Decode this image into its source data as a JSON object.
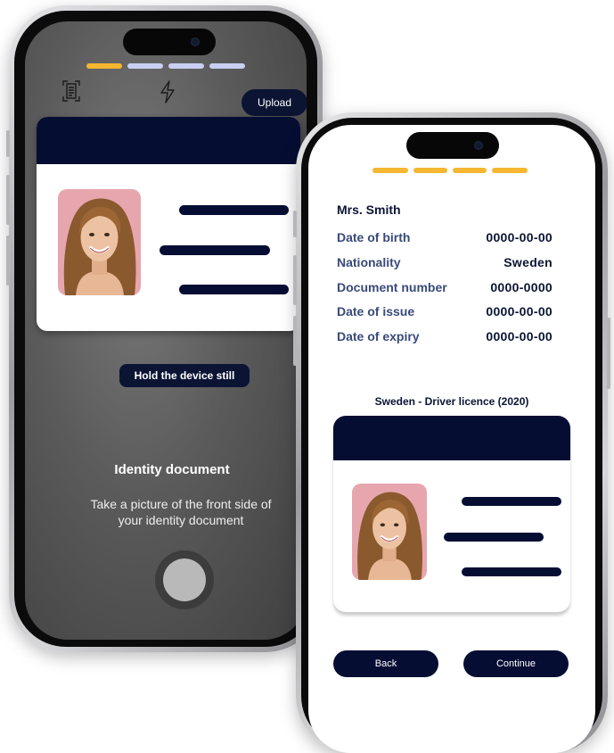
{
  "colors": {
    "navy": "#050d33",
    "progress_active": "#f5b731",
    "progress_inactive": "#c9cff2"
  },
  "scan_screen": {
    "progress": [
      {
        "state": "active"
      },
      {
        "state": "inactive"
      },
      {
        "state": "inactive"
      },
      {
        "state": "inactive"
      }
    ],
    "scan_icon": "document-scan-icon",
    "flash_icon": "flash-icon",
    "upload_label": "Upload",
    "hint": "Hold the device still",
    "title": "Identity document",
    "instruction": "Take a picture of the front side of your identity document"
  },
  "review_screen": {
    "progress": [
      {
        "state": "active"
      },
      {
        "state": "active"
      },
      {
        "state": "active"
      },
      {
        "state": "active"
      }
    ],
    "name": "Mrs. Smith",
    "fields": [
      {
        "label": "Date of birth",
        "value": "0000-00-00"
      },
      {
        "label": "Nationality",
        "value": "Sweden"
      },
      {
        "label": "Document number",
        "value": "0000-0000"
      },
      {
        "label": "Date of issue",
        "value": "0000-00-00"
      },
      {
        "label": "Date of expiry",
        "value": "0000-00-00"
      }
    ],
    "document_title": "Sweden - Driver licence (2020)",
    "back_label": "Back",
    "continue_label": "Continue"
  }
}
